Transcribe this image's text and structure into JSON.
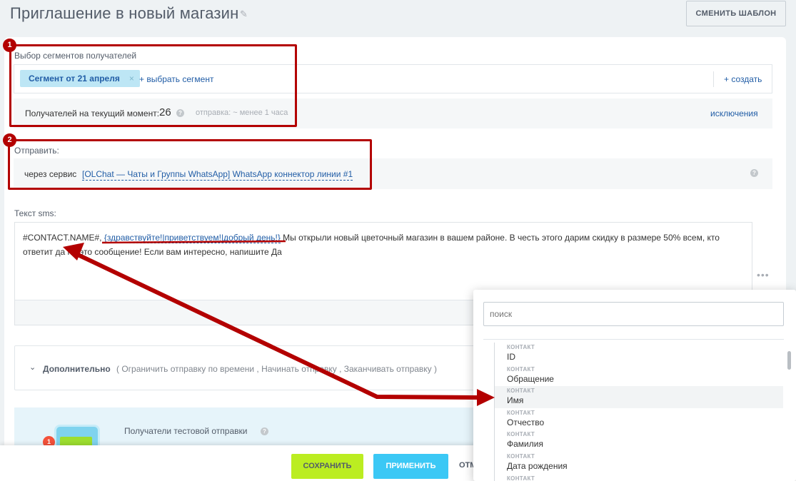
{
  "header": {
    "title": "Приглашение в новый магазин",
    "template_button": "СМЕНИТЬ ШАБЛОН"
  },
  "segments": {
    "label": "Выбор сегментов получателей",
    "selected_chip": "Сегмент от 21 апреля",
    "chip_remove": "×",
    "add_link": "+ выбрать сегмент",
    "create_link": "+ создать",
    "recipients_label": "Получателей на текущий момент:",
    "recipients_count": "26",
    "send_time": "отправка: ~ менее 1 часа",
    "exclusions_link": "исключения"
  },
  "send": {
    "label": "Отправить:",
    "prefix": "через сервис",
    "service": "[OLChat — Чаты и Группы WhatsApp] WhatsApp коннектор линии #1"
  },
  "sms": {
    "label": "Текст sms:",
    "placeholder_var": "#CONTACT.NAME#",
    "comma": ",",
    "greeting_var": "{здравствуйте!|приветствуем!|добрый день!}",
    "body": " Мы открыли новый цветочный магазин в вашем районе. В честь этого дарим скидку в размере 50% всем, кто ответит да на это сообщение! Если вам интересно, напишите Да",
    "more": "•••"
  },
  "extra": {
    "chevron": "⌄",
    "title": "Дополнительно",
    "options": "( Ограничить отправку по времени ,  Начинать отправку ,  Заканчивать отправку  )"
  },
  "test": {
    "label": "Получатели тестовой отправки",
    "badge": "1"
  },
  "footer": {
    "save": "СОХРАНИТЬ",
    "apply": "ПРИМЕНИТЬ",
    "cancel": "ОТМ"
  },
  "popup": {
    "search_placeholder": "поиск",
    "items": [
      {
        "category": "КОНТАКТ",
        "name": "ID"
      },
      {
        "category": "КОНТАКТ",
        "name": "Обращение"
      },
      {
        "category": "КОНТАКТ",
        "name": "Имя"
      },
      {
        "category": "КОНТАКТ",
        "name": "Отчество"
      },
      {
        "category": "КОНТАКТ",
        "name": "Фамилия"
      },
      {
        "category": "КОНТАКТ",
        "name": "Дата рождения"
      },
      {
        "category": "КОНТАКТ",
        "name": ""
      }
    ]
  },
  "annotations": {
    "badge_1": "1",
    "badge_2": "2"
  },
  "colors": {
    "accent": "#215da6",
    "annotation": "#b30000",
    "save": "#bbed21",
    "apply": "#3bc8f5"
  }
}
